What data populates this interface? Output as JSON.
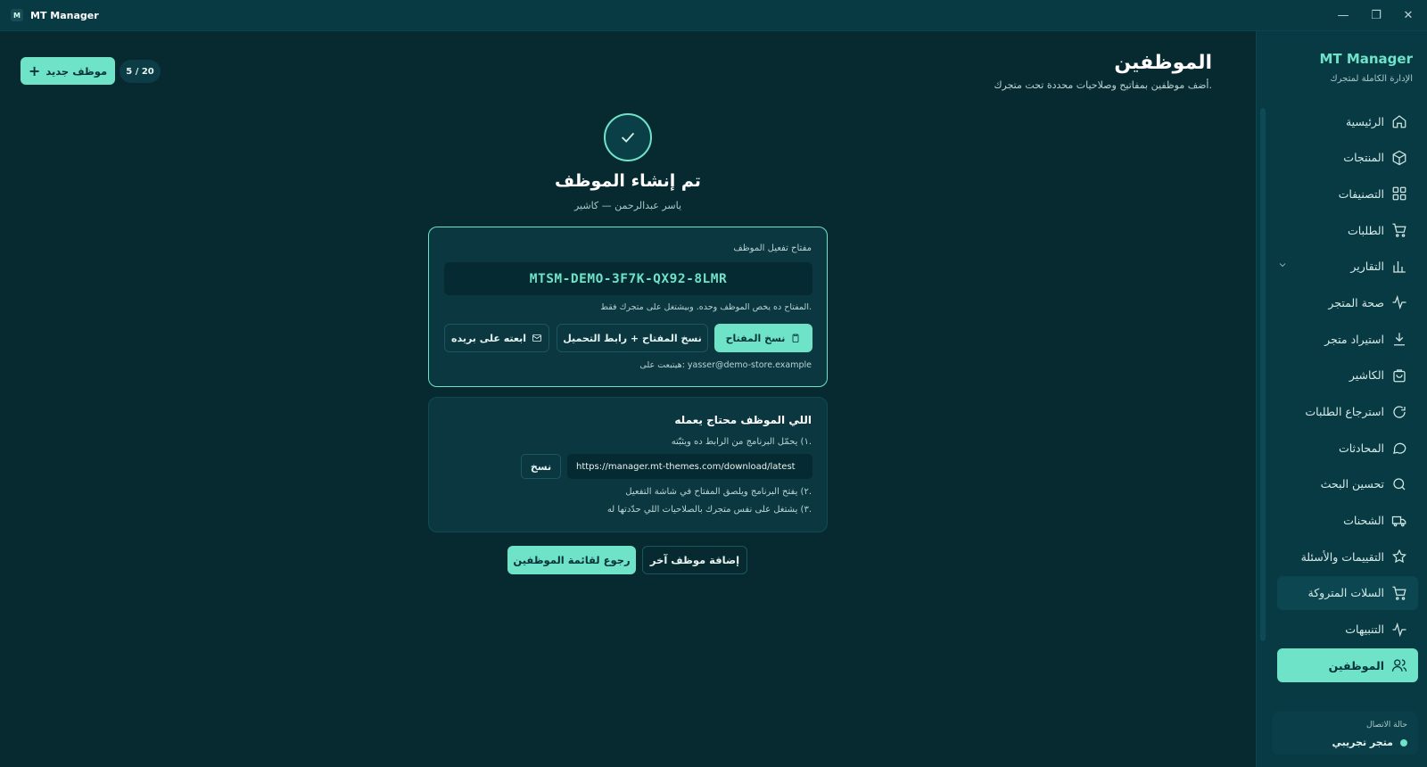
{
  "window": {
    "title": "MT Manager",
    "logo_letter": "M"
  },
  "sidebar": {
    "brand": "MT Manager",
    "brand_sub": "الإدارة الكاملة لمتجرك",
    "items": [
      {
        "label": "الرئيسية",
        "icon": "home-icon"
      },
      {
        "label": "المنتجات",
        "icon": "box-icon"
      },
      {
        "label": "التصنيفات",
        "icon": "grid-icon"
      },
      {
        "label": "الطلبات",
        "icon": "cart-icon"
      },
      {
        "label": "التقارير",
        "icon": "bar-chart-icon"
      },
      {
        "label": "صحة المتجر",
        "icon": "pulse-icon"
      },
      {
        "label": "استيراد متجر",
        "icon": "download-icon"
      },
      {
        "label": "الكاشير",
        "icon": "bag-icon"
      },
      {
        "label": "استرجاع الطلبات",
        "icon": "refresh-icon"
      },
      {
        "label": "المحادثات",
        "icon": "chat-icon"
      },
      {
        "label": "تحسين البحث",
        "icon": "search-icon"
      },
      {
        "label": "الشحنات",
        "icon": "truck-icon"
      },
      {
        "label": "التقييمات والأسئلة",
        "icon": "star-icon"
      },
      {
        "label": "السلات المتروكة",
        "icon": "cart-icon"
      },
      {
        "label": "التنبيهات",
        "icon": "pulse-icon"
      },
      {
        "label": "الموظفين",
        "icon": "users-icon"
      }
    ],
    "connection_label": "حالة الاتصال",
    "connection_status": "متجر تجريبي"
  },
  "header": {
    "title": "الموظفين",
    "subtitle": "أضف موظفين بمفاتيح وصلاحيات محددة تحت متجرك.",
    "new_button": "موظف جديد",
    "count": "5 / 20"
  },
  "success": {
    "title": "تم إنشاء الموظف",
    "subtitle": "ياسر عبدالرحمن — كاشير"
  },
  "key_card": {
    "label": "مفتاح تفعيل الموظف",
    "key": "MTSM-DEMO-3F7K-QX92-8LMR",
    "note": "المفتاح ده يخص الموظف وحده. وبيشتغل على متجرك فقط.",
    "copy_key": "نسخ المفتاح",
    "copy_key_link": "نسخ المفتاح + رابط التحميل",
    "send_email": "ابعته على بريده",
    "send_note": "هيتبعت على: yasser@demo-store.example"
  },
  "steps_card": {
    "title": "اللي الموظف محتاج يعمله",
    "step1": "١) يحمّل البرنامج من الرابط ده ويثبّته.",
    "url": "https://manager.mt-themes.com/download/latest",
    "copy": "نسخ",
    "step2": "٢) يفتح البرنامج ويلصق المفتاح في شاشة التفعيل.",
    "step3": "٣) يشتغل على نفس متجرك بالصلاحيات اللي حدّدتها له."
  },
  "footer": {
    "back": "رجوع لقائمة الموظفين",
    "another": "إضافة موظف آخر"
  },
  "colors": {
    "accent": "#6fe3c8",
    "background": "#072a31",
    "sidebar": "#083a44"
  }
}
